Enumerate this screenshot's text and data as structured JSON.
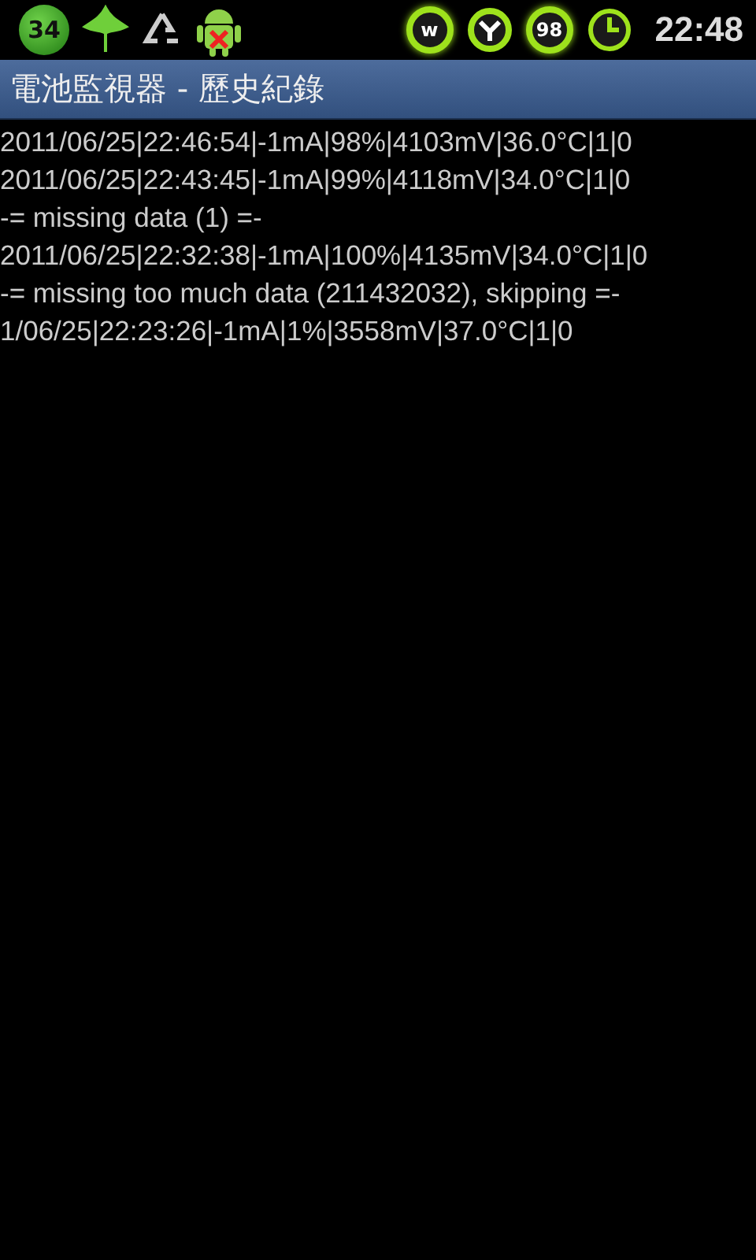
{
  "status_bar": {
    "badge": "34",
    "indicators": [
      {
        "kind": "text",
        "text": "w"
      },
      {
        "kind": "antenna"
      },
      {
        "kind": "text",
        "text": "98"
      },
      {
        "kind": "clock"
      }
    ],
    "time": "22:48"
  },
  "title_bar": {
    "title": "電池監視器 - 歷史紀錄"
  },
  "log_lines": [
    "2011/06/25|22:46:54|-1mA|98%|4103mV|36.0°C|1|0",
    "2011/06/25|22:43:45|-1mA|99%|4118mV|34.0°C|1|0",
    "-= missing data (1) =-",
    "2011/06/25|22:32:38|-1mA|100%|4135mV|34.0°C|1|0",
    "-= missing too much data (211432032), skipping =-",
    "1/06/25|22:23:26|-1mA|1%|3558mV|37.0°C|1|0"
  ]
}
